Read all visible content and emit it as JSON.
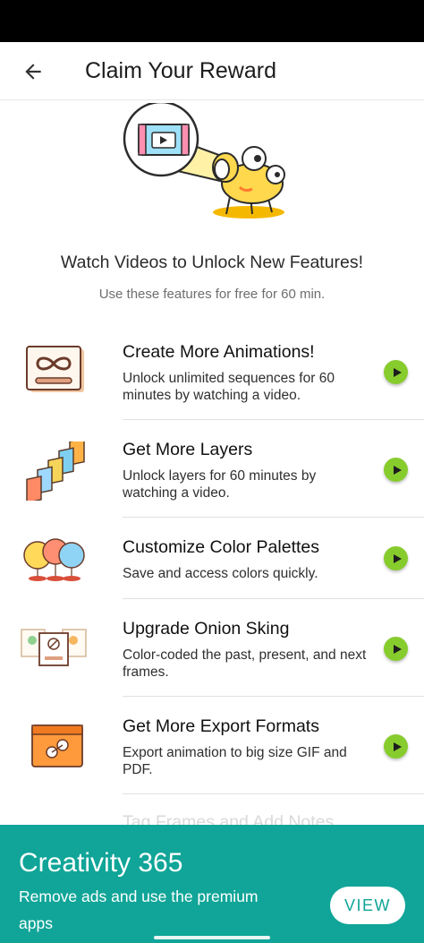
{
  "header": {
    "title": "Claim Your Reward",
    "back_icon": "arrow-left-icon"
  },
  "hero": {
    "headline": "Watch Videos to Unlock New Features!",
    "subtext": "Use these features for free for 60 min."
  },
  "features": [
    {
      "title": "Create More Animations!",
      "description": "Unlock unlimited sequences for 60 minutes by watching a video.",
      "icon": "infinity-frame-icon"
    },
    {
      "title": "Get More Layers",
      "description": "Unlock layers for 60 minutes by watching a video.",
      "icon": "stacked-layers-icon"
    },
    {
      "title": "Customize Color Palettes",
      "description": "Save and access colors quickly.",
      "icon": "color-balloons-icon"
    },
    {
      "title": "Upgrade Onion Sking",
      "description": "Color-coded the past, present, and next frames.",
      "icon": "onion-frames-icon"
    },
    {
      "title": "Get More Export Formats",
      "description": "Export animation to big size GIF and PDF.",
      "icon": "export-folder-icon"
    }
  ],
  "partial_item": {
    "title": "Tag Frames and Add Notes"
  },
  "promo": {
    "title": "Creativity 365",
    "description": "Remove ads and use the premium apps",
    "button_label": "VIEW"
  },
  "colors": {
    "accent": "#10a598",
    "play": "#87cc2d",
    "status_bar": "#000000"
  }
}
